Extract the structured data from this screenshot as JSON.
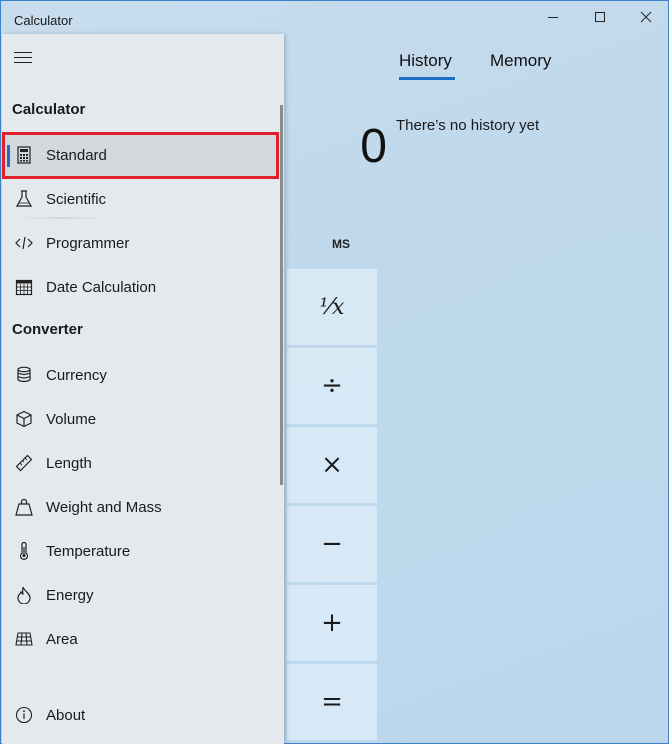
{
  "window": {
    "title": "Calculator",
    "controls": {
      "minimize": "minimize",
      "maximize": "maximize",
      "close": "close"
    }
  },
  "display": {
    "value": "0",
    "memory_store_label": "MS"
  },
  "keys": [
    {
      "name": "reciprocal",
      "label": "⅟x"
    },
    {
      "name": "divide",
      "label": "÷"
    },
    {
      "name": "multiply",
      "label": "×"
    },
    {
      "name": "subtract",
      "label": "−"
    },
    {
      "name": "add",
      "label": "+"
    },
    {
      "name": "equals",
      "label": "="
    }
  ],
  "history_panel": {
    "tabs": [
      {
        "label": "History",
        "selected": true
      },
      {
        "label": "Memory",
        "selected": false
      }
    ],
    "empty_message": "There’s no history yet"
  },
  "nav": {
    "sections": [
      {
        "title": "Calculator",
        "items": [
          {
            "label": "Standard",
            "icon": "calculator-icon",
            "selected": true
          },
          {
            "label": "Scientific",
            "icon": "flask-icon",
            "selected": false
          },
          {
            "label": "Programmer",
            "icon": "code-icon",
            "selected": false
          },
          {
            "label": "Date Calculation",
            "icon": "calendar-icon",
            "selected": false
          }
        ]
      },
      {
        "title": "Converter",
        "items": [
          {
            "label": "Currency",
            "icon": "coins-icon"
          },
          {
            "label": "Volume",
            "icon": "cube-icon"
          },
          {
            "label": "Length",
            "icon": "ruler-icon"
          },
          {
            "label": "Weight and Mass",
            "icon": "weight-icon"
          },
          {
            "label": "Temperature",
            "icon": "thermometer-icon"
          },
          {
            "label": "Energy",
            "icon": "flame-icon"
          },
          {
            "label": "Area",
            "icon": "grid-icon"
          }
        ]
      }
    ],
    "footer": {
      "label": "About",
      "icon": "info-icon"
    }
  },
  "colors": {
    "accent": "#1a6fc2",
    "highlight_box": "#e0202a",
    "window_border": "#3c82c8"
  }
}
